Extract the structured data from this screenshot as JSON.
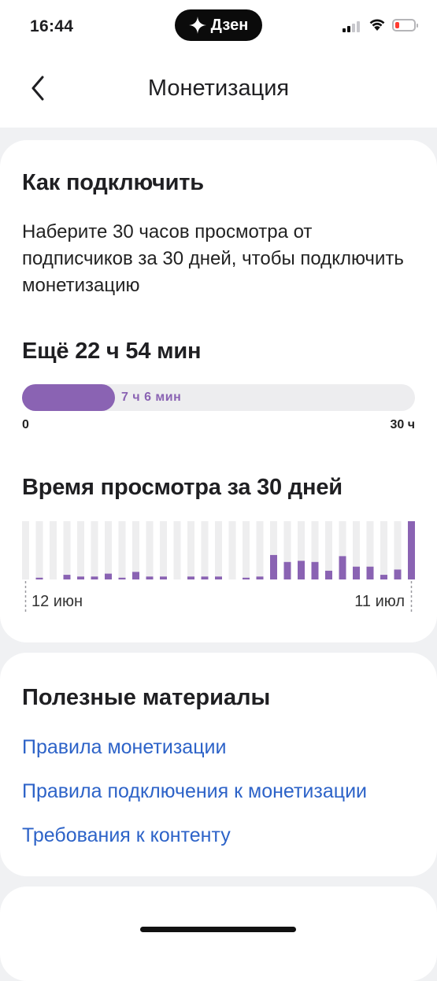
{
  "status_bar": {
    "time": "16:44",
    "pill_label": "Дзен",
    "signal_bars_active": 2,
    "battery_level": 0.15,
    "battery_color": "#ff3b30"
  },
  "header": {
    "title": "Монетизация",
    "back_icon": "chevron-left-icon"
  },
  "how_to": {
    "title": "Как подключить",
    "description": "Наберите 30 часов просмотра от подписчиков за 30 дней, чтобы подключить монетизацию",
    "remaining": "Ещё 22 ч 54 мин",
    "progress": {
      "label": "7 ч 6 мин",
      "value_hours": 7.1,
      "max_hours": 30,
      "min_label": "0",
      "max_label": "30 ч",
      "color": "#8a63b3"
    }
  },
  "chart_title": "Время просмотра за 30 дней",
  "chart_data": {
    "type": "bar",
    "title": "Время просмотра за 30 дней",
    "start_label": "12 июн",
    "end_label": "11 июл",
    "values": [
      0,
      0.03,
      0,
      0.08,
      0.05,
      0.05,
      0.1,
      0.03,
      0.13,
      0.05,
      0.05,
      0,
      0.05,
      0.05,
      0.05,
      0,
      0.03,
      0.05,
      0.42,
      0.3,
      0.32,
      0.3,
      0.15,
      0.4,
      0.22,
      0.22,
      0.08,
      0.17,
      1.0
    ],
    "bar_color": "#8a63b3",
    "track_color": "#eeeeef"
  },
  "materials": {
    "title": "Полезные материалы",
    "links": [
      "Правила монетизации",
      "Правила подключения к монетизации",
      "Требования к контенту"
    ],
    "link_color": "#2d63c8"
  }
}
